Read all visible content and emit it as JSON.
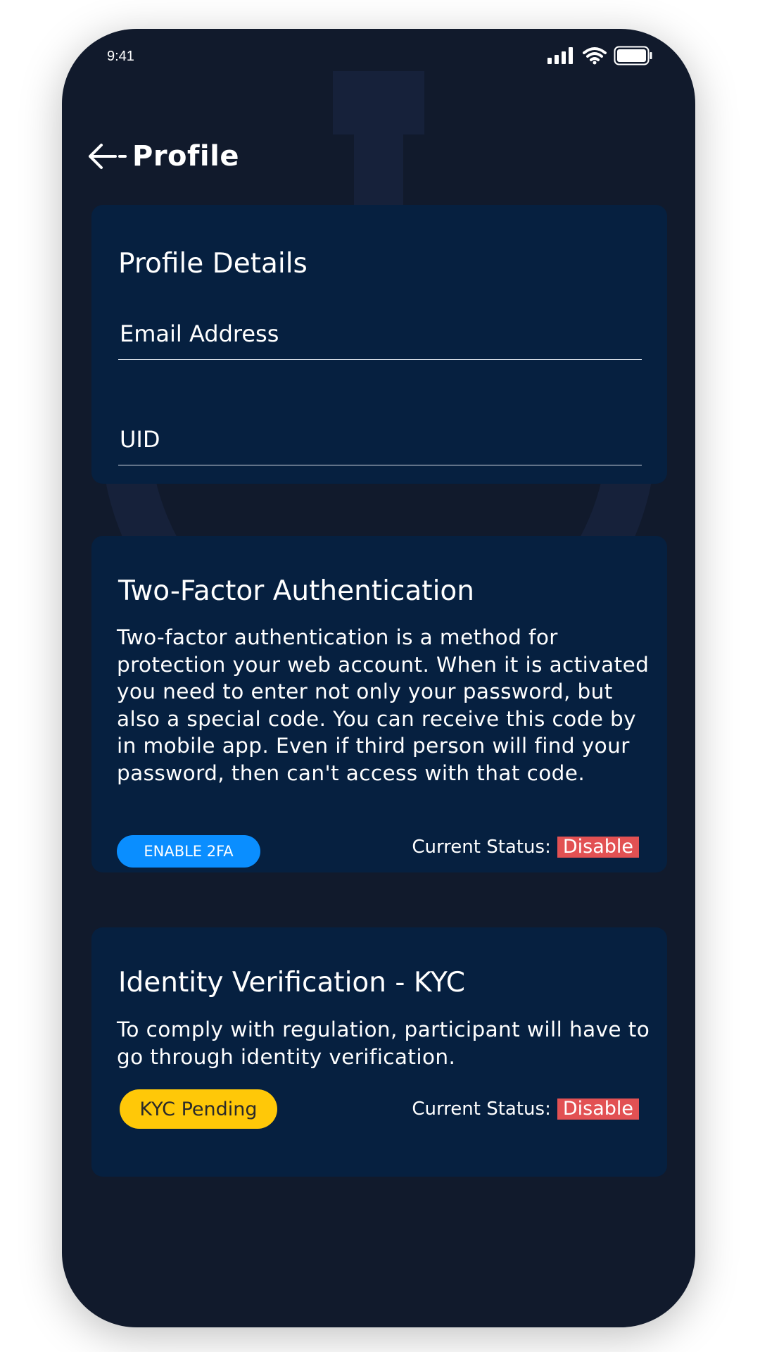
{
  "status_bar": {
    "time": "9:41"
  },
  "header": {
    "title": "Profile",
    "back_icon": "arrow-left-icon"
  },
  "profile_details": {
    "title": "Profile Details",
    "email_placeholder": "Email Address",
    "uid_placeholder": "UID"
  },
  "two_factor": {
    "title": "Two-Factor Authentication",
    "description": "Two-factor authentication is a method for protection your web account. When it is activated you need to enter not only your password, but also a special code. You can receive this code by in mobile app. Even if third person will find your password, then can't access with that code.",
    "button_label": "ENABLE 2FA",
    "status_label": "Current Status:",
    "status_value": "Disable"
  },
  "kyc": {
    "title": "Identity Verification - KYC",
    "description": "To comply with regulation, participant will have to go through identity verification.",
    "button_label": "KYC Pending",
    "status_label": "Current Status:",
    "status_value": "Disable"
  },
  "colors": {
    "background": "#111a2c",
    "card": "#062040",
    "primary_button": "#0a8eff",
    "pending_button": "#ffc808",
    "status_disable": "#e25153"
  }
}
